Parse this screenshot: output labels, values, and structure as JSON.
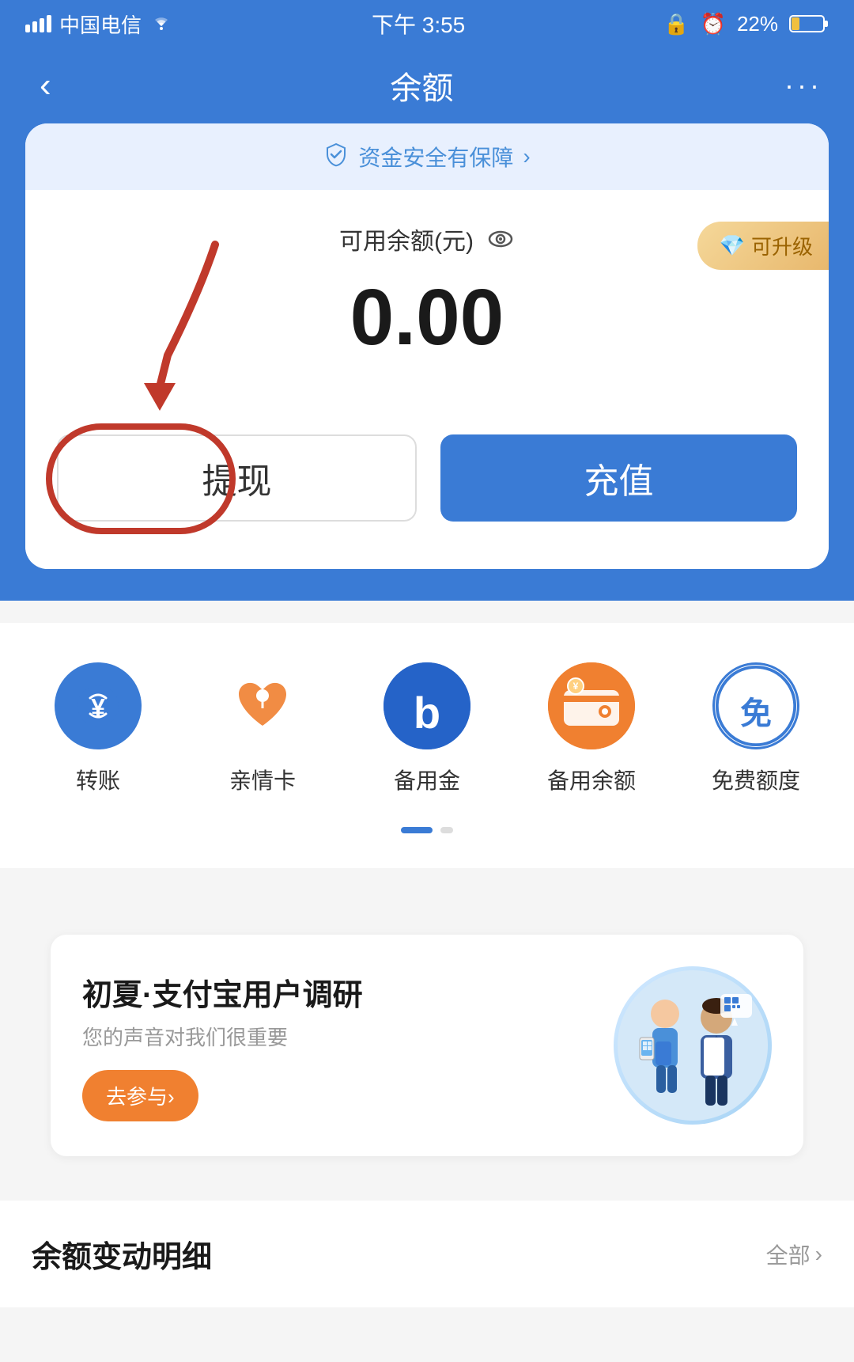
{
  "statusBar": {
    "carrier": "中国电信",
    "time": "下午 3:55",
    "battery": "22%",
    "wifi": true
  },
  "header": {
    "backLabel": "‹",
    "title": "余额",
    "moreLabel": "···"
  },
  "securityBanner": {
    "label": "资金安全有保障",
    "chevron": "›"
  },
  "balance": {
    "label": "可用余额(元)",
    "amount": "0.00",
    "upgradeBadge": "可升级"
  },
  "buttons": {
    "withdraw": "提现",
    "topup": "充值"
  },
  "features": [
    {
      "id": "transfer",
      "icon": "¥",
      "label": "转账",
      "color": "#3a7bd5"
    },
    {
      "id": "family",
      "icon": "♥",
      "label": "亲情卡",
      "color": "#f08030"
    },
    {
      "id": "reserve",
      "icon": "b",
      "label": "备用金",
      "color": "#2d5fc4"
    },
    {
      "id": "reserveBalance",
      "icon": "👜",
      "label": "备用余额",
      "color": "#f08030"
    },
    {
      "id": "freeLimit",
      "icon": "免",
      "label": "免费额度",
      "color": "#3a7bd5"
    }
  ],
  "survey": {
    "title": "初夏·支付宝用户调研",
    "subtitle": "您的声音对我们很重要",
    "buttonLabel": "去参与›"
  },
  "transactions": {
    "title": "余额变动明细",
    "allLabel": "全部",
    "chevron": "›"
  }
}
